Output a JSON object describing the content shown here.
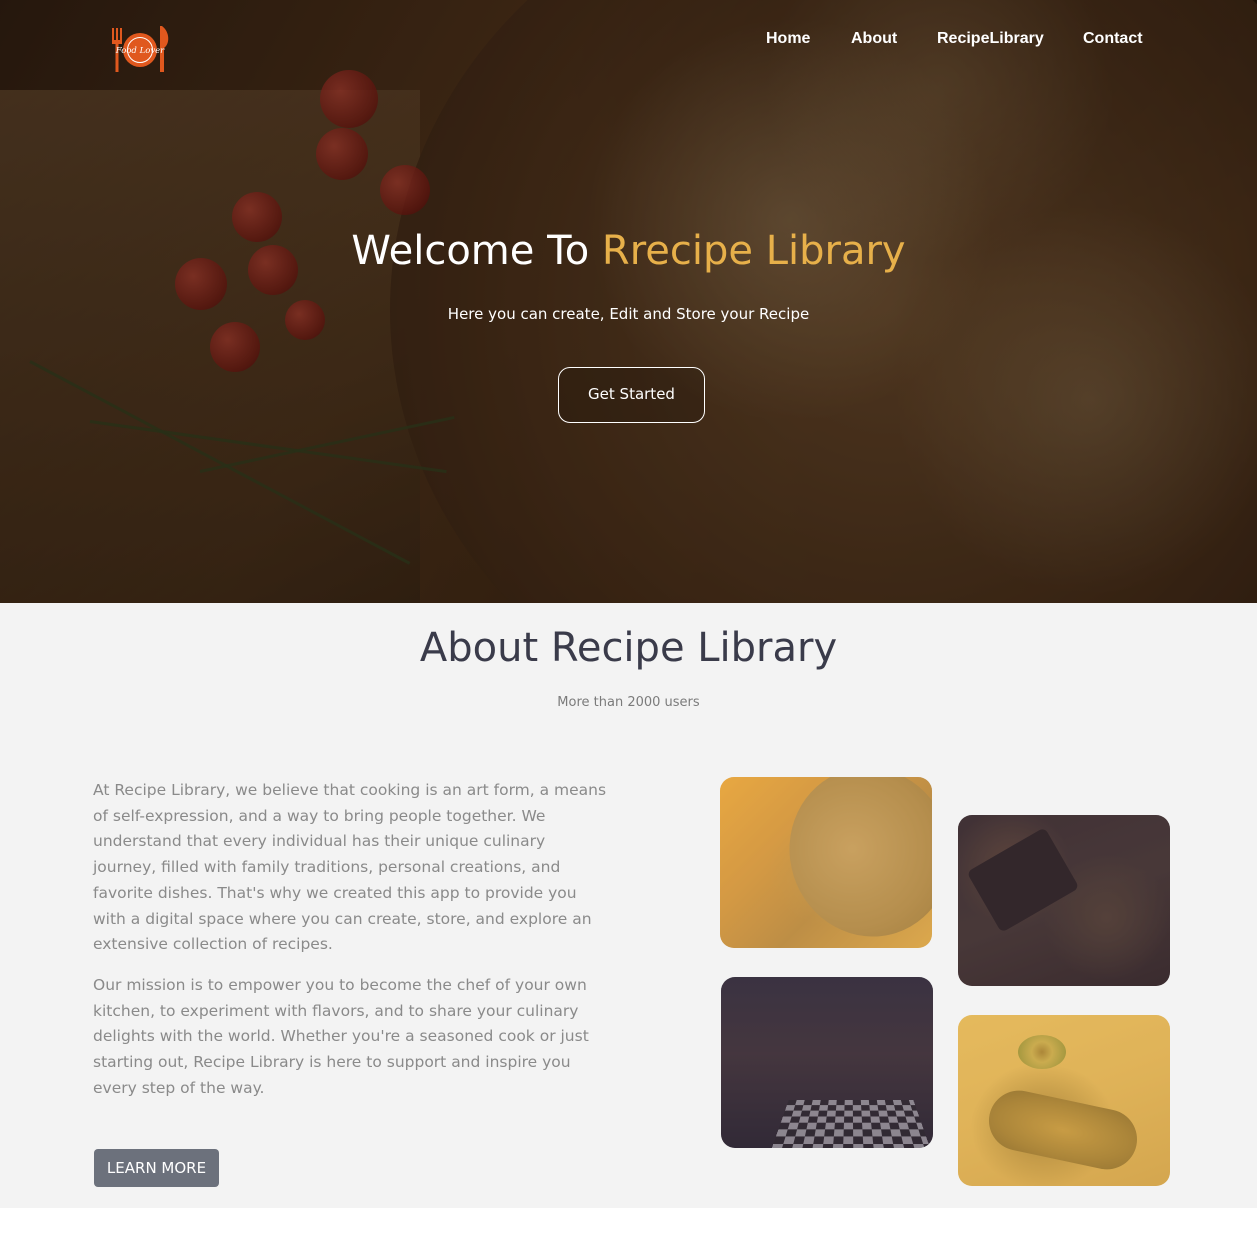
{
  "brand": {
    "logo_text": "Food Lover"
  },
  "nav": {
    "items": [
      {
        "label": "Home"
      },
      {
        "label": "About"
      },
      {
        "label": "RecipeLibrary"
      },
      {
        "label": "Contact"
      }
    ]
  },
  "hero": {
    "title_prefix": "Welcome To ",
    "title_accent": "Rrecipe Library",
    "subtitle": "Here you can create, Edit and Store your Recipe",
    "cta_label": "Get Started"
  },
  "about": {
    "title": "About Recipe Library",
    "subtitle": "More than 2000 users",
    "paragraph1": "At Recipe Library, we believe that cooking is an art form, a means of self-expression, and a way to bring people together. We understand that every individual has their unique culinary journey, filled with family traditions, personal creations, and favorite dishes. That's why we created this app to provide you with a digital space where you can create, store, and explore an extensive collection of recipes.",
    "paragraph2": "Our mission is to empower you to become the chef of your own kitchen, to experiment with flavors, and to share your culinary delights with the world. Whether you're a seasoned cook or just starting out, Recipe Library is here to support and inspire you every step of the way.",
    "button_label": "LEARN MORE"
  },
  "colors": {
    "accent": "#e7b04a",
    "logo": "#e0581e",
    "button_gray": "#6c717c",
    "about_bg": "#f3f3f3",
    "heading_dark": "#3a3b4a"
  }
}
